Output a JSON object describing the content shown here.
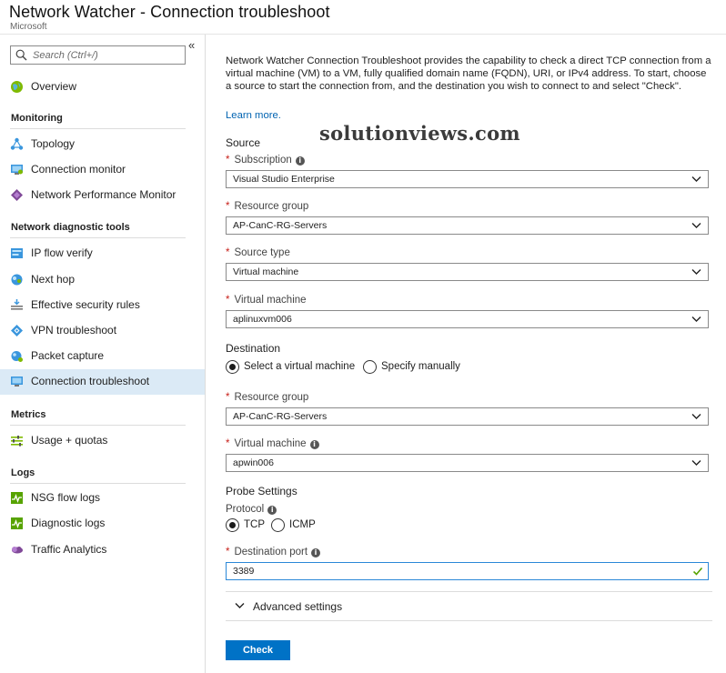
{
  "header": {
    "title": "Network Watcher - Connection troubleshoot",
    "subtitle": "Microsoft"
  },
  "sidebar": {
    "search_placeholder": "Search (Ctrl+/)",
    "collapse_glyph": "«",
    "top_items": [
      {
        "label": "Overview",
        "icon": "globe-icon"
      }
    ],
    "sections": [
      {
        "title": "Monitoring",
        "items": [
          {
            "label": "Topology",
            "icon": "topology-icon"
          },
          {
            "label": "Connection monitor",
            "icon": "monitor-icon"
          },
          {
            "label": "Network Performance Monitor",
            "icon": "diamond-icon"
          }
        ]
      },
      {
        "title": "Network diagnostic tools",
        "items": [
          {
            "label": "IP flow verify",
            "icon": "ip-flow-icon"
          },
          {
            "label": "Next hop",
            "icon": "next-hop-icon"
          },
          {
            "label": "Effective security rules",
            "icon": "security-rules-icon"
          },
          {
            "label": "VPN troubleshoot",
            "icon": "vpn-icon"
          },
          {
            "label": "Packet capture",
            "icon": "packet-capture-icon"
          },
          {
            "label": "Connection troubleshoot",
            "icon": "connection-troubleshoot-icon",
            "active": true
          }
        ]
      },
      {
        "title": "Metrics",
        "items": [
          {
            "label": "Usage + quotas",
            "icon": "usage-icon"
          }
        ]
      },
      {
        "title": "Logs",
        "items": [
          {
            "label": "NSG flow logs",
            "icon": "nsg-logs-icon"
          },
          {
            "label": "Diagnostic logs",
            "icon": "diagnostic-logs-icon"
          },
          {
            "label": "Traffic Analytics",
            "icon": "traffic-analytics-icon"
          }
        ]
      }
    ]
  },
  "main": {
    "description": "Network Watcher Connection Troubleshoot provides the capability to check a direct TCP connection from a virtual machine (VM) to a VM, fully qualified domain name (FQDN), URI, or IPv4 address. To start, choose a source to start the connection from, and the destination you wish to connect to and select \"Check\".",
    "learn_more": "Learn more.",
    "watermark": "solutionviews.com",
    "source": {
      "heading": "Source",
      "subscription": {
        "label": "Subscription",
        "value": "Visual Studio Enterprise"
      },
      "resource_group": {
        "label": "Resource group",
        "value": "AP-CanC-RG-Servers"
      },
      "source_type": {
        "label": "Source type",
        "value": "Virtual machine"
      },
      "virtual_machine": {
        "label": "Virtual machine",
        "value": "aplinuxvm006"
      }
    },
    "destination": {
      "heading": "Destination",
      "option_select": "Select a virtual machine",
      "option_manual": "Specify manually",
      "selected_option": "Select a virtual machine",
      "resource_group": {
        "label": "Resource group",
        "value": "AP-CanC-RG-Servers"
      },
      "virtual_machine": {
        "label": "Virtual machine",
        "value": "apwin006"
      }
    },
    "probe": {
      "heading": "Probe Settings",
      "protocol_label": "Protocol",
      "protocol_options": [
        "TCP",
        "ICMP"
      ],
      "selected_protocol": "TCP",
      "port_label": "Destination port",
      "port_value": "3389"
    },
    "advanced_label": "Advanced settings",
    "check_button": "Check"
  },
  "colors": {
    "accent": "#0072c6",
    "link": "#0063b1",
    "required": "#c8211b",
    "active_nav_bg": "#dbeaf6",
    "valid_check": "#57a300"
  }
}
